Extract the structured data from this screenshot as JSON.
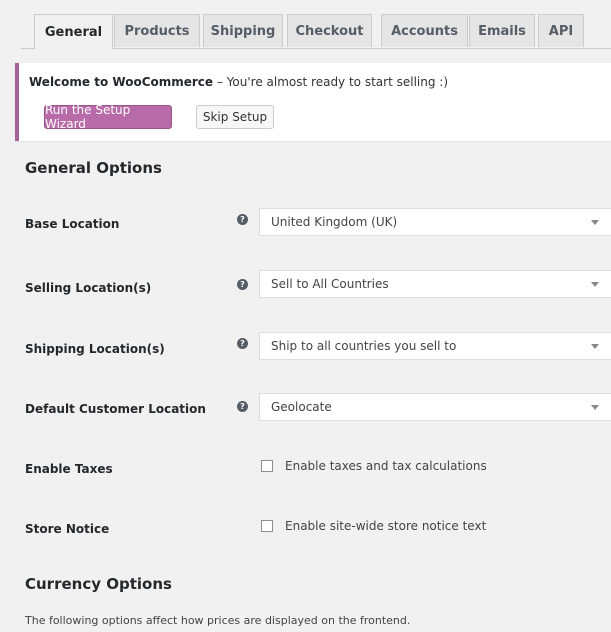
{
  "tabs": [
    {
      "label": "General",
      "active": true
    },
    {
      "label": "Products",
      "active": false
    },
    {
      "label": "Shipping",
      "active": false
    },
    {
      "label": "Checkout",
      "active": false
    },
    {
      "label": "Accounts",
      "active": false
    },
    {
      "label": "Emails",
      "active": false
    },
    {
      "label": "API",
      "active": false
    }
  ],
  "notice": {
    "title": "Welcome to WooCommerce",
    "message": " – You're almost ready to start selling :)",
    "primary_button": "Run the Setup Wizard",
    "secondary_button": "Skip Setup"
  },
  "general_options": {
    "title": "General Options",
    "base_location": {
      "label": "Base Location",
      "value": "United Kingdom (UK)"
    },
    "selling_locations": {
      "label": "Selling Location(s)",
      "value": "Sell to All Countries"
    },
    "shipping_locations": {
      "label": "Shipping Location(s)",
      "value": "Ship to all countries you sell to"
    },
    "default_customer_location": {
      "label": "Default Customer Location",
      "value": "Geolocate"
    },
    "enable_taxes": {
      "label": "Enable Taxes",
      "checkbox_label": "Enable taxes and tax calculations",
      "checked": false
    },
    "store_notice": {
      "label": "Store Notice",
      "checkbox_label": "Enable site-wide store notice text",
      "checked": false
    },
    "help_glyph": "?"
  },
  "currency_options": {
    "title": "Currency Options",
    "description": "The following options affect how prices are displayed on the frontend."
  },
  "colors": {
    "accent": "#a46497",
    "primary_button": "#b96aa8",
    "background": "#f1f1f1"
  }
}
